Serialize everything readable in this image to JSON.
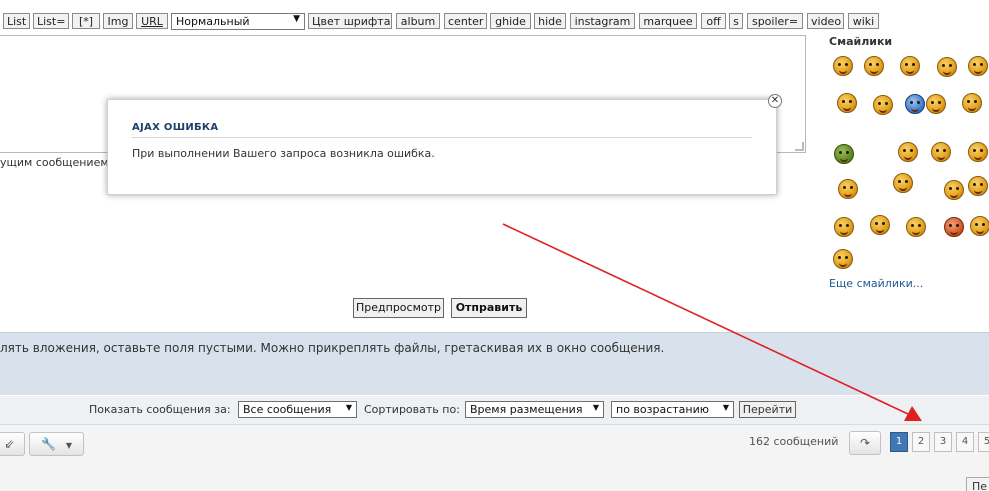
{
  "toolbar": {
    "buttons": [
      "List",
      "List=",
      "[*]",
      "Img",
      "URL",
      "Цвет шрифта",
      "album",
      "center",
      "ghide",
      "hide",
      "instagram",
      "marquee",
      "off",
      "s",
      "spoiler=",
      "video",
      "wiki"
    ],
    "size_select": "Нормальный"
  },
  "editor": {
    "hint_fragment": "ущим сообщением"
  },
  "smilies": {
    "title": "Смайлики",
    "more_link": "Еще смайлики..."
  },
  "modal": {
    "title": "AJAX ОШИБКА",
    "message": "При выполнении Вашего запроса возникла ошибка.",
    "close": "✕"
  },
  "submit": {
    "preview_label": "Предпросмотр",
    "send_label": "Отправить"
  },
  "attachments": {
    "text": "лять вложения, оставьте поля пустыми. Можно прикреплять файлы, гретаскивая их в окно сообщения."
  },
  "sort": {
    "show_label": "Показать сообщения за:",
    "show_value": "Все сообщения",
    "sort_label": "Сортировать по:",
    "sort_value": "Время размещения",
    "order_value": "по возрастанию",
    "go_label": "Перейти"
  },
  "bottom": {
    "message_count": "162 сообщений",
    "pages": [
      "1",
      "2",
      "3",
      "4",
      "5"
    ],
    "next_fragment": "Пе"
  },
  "colors": {
    "accent": "#3f78b3",
    "arrow": "#e02020",
    "attach_bg": "#d9e2ec"
  }
}
